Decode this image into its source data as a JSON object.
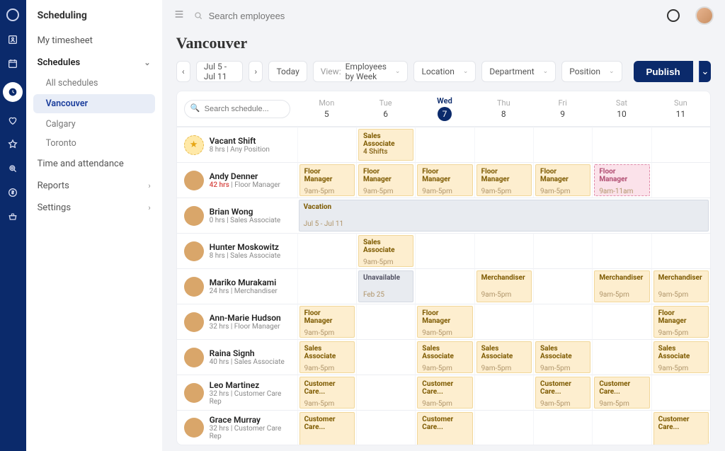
{
  "sidebar": {
    "title": "Scheduling",
    "timesheet": "My timesheet",
    "schedules": "Schedules",
    "all": "All schedules",
    "loc1": "Vancouver",
    "loc2": "Calgary",
    "loc3": "Toronto",
    "timeatt": "Time and attendance",
    "reports": "Reports",
    "settings": "Settings"
  },
  "top": {
    "search_placeholder": "Search employees"
  },
  "title": "Vancouver",
  "toolbar": {
    "range": "Jul 5 - Jul 11",
    "today": "Today",
    "view_prefix": "View:",
    "view_value": " Employees by Week",
    "location": "Location",
    "department": "Department",
    "position": "Position",
    "publish": "Publish"
  },
  "grid": {
    "search_placeholder": "Search schedule...",
    "days": [
      {
        "d": "Mon",
        "n": "5"
      },
      {
        "d": "Tue",
        "n": "6"
      },
      {
        "d": "Wed",
        "n": "7",
        "active": true
      },
      {
        "d": "Thu",
        "n": "8"
      },
      {
        "d": "Fri",
        "n": "9"
      },
      {
        "d": "Sat",
        "n": "10"
      },
      {
        "d": "Sun",
        "n": "11"
      }
    ]
  },
  "rows": {
    "vacant": {
      "name": "Vacant Shift",
      "sub": "8 hrs | Any Position",
      "role": "Sales Associate",
      "extra": "4 Shifts",
      "time": "9am-5pm"
    },
    "andy": {
      "name": "Andy Denner",
      "hrs": "42 hrs",
      "pos": " | Floor Manager",
      "role": "Floor Manager",
      "time": "9am-5pm",
      "sat_time": "9am-11am"
    },
    "brian": {
      "name": "Brian Wong",
      "sub": "0 hrs | Sales Associate",
      "role": "Vacation",
      "time": "Jul 5 - Jul 11"
    },
    "hunter": {
      "name": "Hunter Moskowitz",
      "sub": "8 hrs | Sales Associate",
      "role": "Sales Associate",
      "time": "9am-5pm"
    },
    "mariko": {
      "name": "Mariko Murakami",
      "sub": "24 hrs | Merchandiser",
      "role": "Merchandiser",
      "time": "9am-5pm",
      "un_role": "Unavailable",
      "un_time": "Feb 25"
    },
    "ann": {
      "name": "Ann-Marie Hudson",
      "sub": "32 hrs | Floor Manager",
      "role": "Floor Manager",
      "time": "9am-5pm"
    },
    "raina": {
      "name": "Raina Signh",
      "sub": "40 hrs | Sales Associate",
      "role": "Sales Associate",
      "time": "9am-5pm"
    },
    "leo": {
      "name": "Leo Martinez",
      "sub": "32 hrs | Customer Care Rep",
      "role": "Customer Care...",
      "time": "9am-5pm"
    },
    "grace": {
      "name": "Grace Murray",
      "sub": "32 hrs | Customer Care Rep",
      "role": "Customer Care..."
    }
  }
}
